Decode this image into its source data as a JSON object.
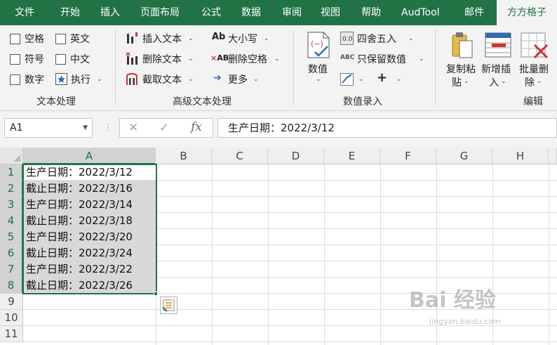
{
  "menu": {
    "items": [
      "文件",
      "开始",
      "插入",
      "页面布局",
      "公式",
      "数据",
      "审阅",
      "视图",
      "帮助",
      "AudTool",
      "邮件"
    ],
    "active_tab": "方方格子"
  },
  "ribbon": {
    "text_processing": {
      "checkboxes": [
        "空格",
        "英文",
        "符号",
        "中文",
        "数字"
      ],
      "execute_label": "执行",
      "group_label": "文本处理"
    },
    "advanced_text": {
      "insert_label": "插入文本",
      "delete_label": "删除文本",
      "extract_label": "截取文本",
      "case_label": "大小写",
      "remove_space_label": "删除空格",
      "more_label": "更多",
      "group_label": "高级文本处理"
    },
    "number_entry": {
      "number_label": "数值",
      "round_label": "四舍五入",
      "keep_numbers_label": "只保留数值",
      "plus_label": "+",
      "group_label": "数值录入"
    },
    "edit": {
      "copy_paste_line1": "复制粘",
      "copy_paste_line2": "贴",
      "new_insert_line1": "新增插",
      "new_insert_line2": "入",
      "batch_delete_line1": "批量删",
      "batch_delete_line2": "除",
      "group_label": "编辑"
    }
  },
  "formula_bar": {
    "name_box": "A1",
    "cancel_symbol": "✕",
    "enter_symbol": "✓",
    "fx_label": "fx",
    "formula_value": "生产日期：2022/3/12"
  },
  "sheet": {
    "columns": [
      "A",
      "B",
      "C",
      "D",
      "E",
      "F",
      "G",
      "H"
    ],
    "selected_column": "A",
    "rows": [
      "1",
      "2",
      "3",
      "4",
      "5",
      "6",
      "7",
      "8",
      "9",
      "10",
      "11"
    ],
    "cells_A": [
      "生产日期：2022/3/12",
      "截止日期：2022/3/16",
      "生产日期：2022/3/14",
      "截止日期：2022/3/18",
      "生产日期：2022/3/20",
      "截止日期：2022/3/24",
      "生产日期：2022/3/22",
      "截止日期：2022/3/26"
    ]
  },
  "watermark": {
    "text": "Bai 经验",
    "sub": "jingyan.baidu.com"
  },
  "colors": {
    "accent": "#217346",
    "ribbon_bg": "#f3f3f3",
    "selection_fill": "#d8d8d8"
  }
}
